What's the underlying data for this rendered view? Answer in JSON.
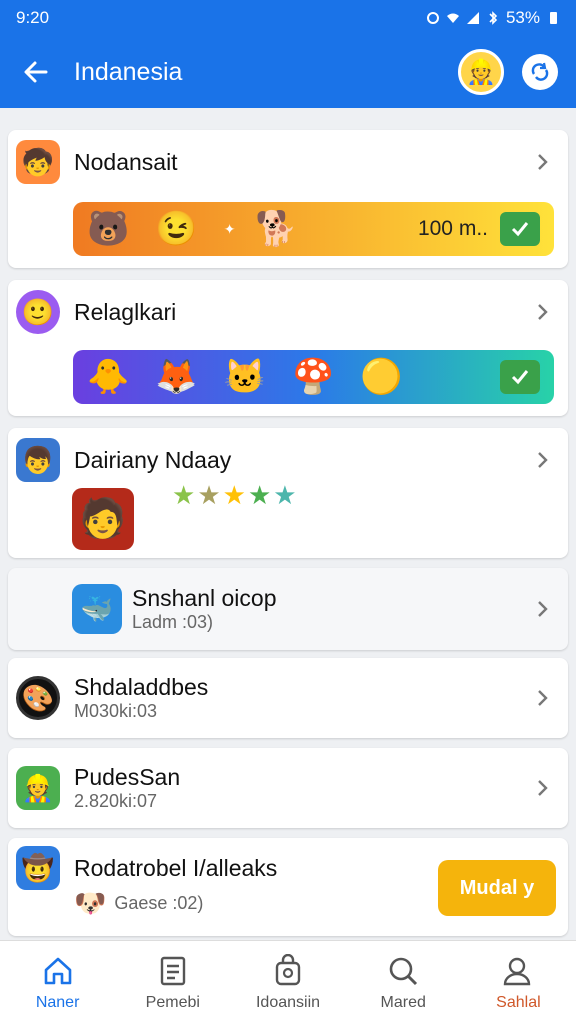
{
  "status": {
    "time": "9:20",
    "battery": "53%"
  },
  "appbar": {
    "title": "Indanesia"
  },
  "items": [
    {
      "name": "Nodansait",
      "bar_text": "100 m..",
      "icon": "kid-icon"
    },
    {
      "name": "Relaglkari",
      "icon": "face-icon"
    },
    {
      "name": "Dairiany Ndaay",
      "icon": "boy-icon"
    },
    {
      "name": "Snshanl oicop",
      "sub": "Ladm :03)"
    },
    {
      "name": "Shdaladdbes",
      "sub": "M030ki:03"
    },
    {
      "name": "PudesSan",
      "sub": "2.820ki:07"
    },
    {
      "name": "Rodatrobel I/alleaks",
      "sub": "Gaese :02)",
      "button": "Mudal y"
    }
  ],
  "nav": [
    {
      "label": "Naner",
      "active": true
    },
    {
      "label": "Pemebi"
    },
    {
      "label": "Idoansiin"
    },
    {
      "label": "Mared"
    },
    {
      "label": "Sahlal"
    }
  ],
  "colors": {
    "primary": "#1a73e8",
    "accent": "#f5b40c",
    "active_nav": "#1a73e8",
    "profile_nav": "#d0582a"
  }
}
